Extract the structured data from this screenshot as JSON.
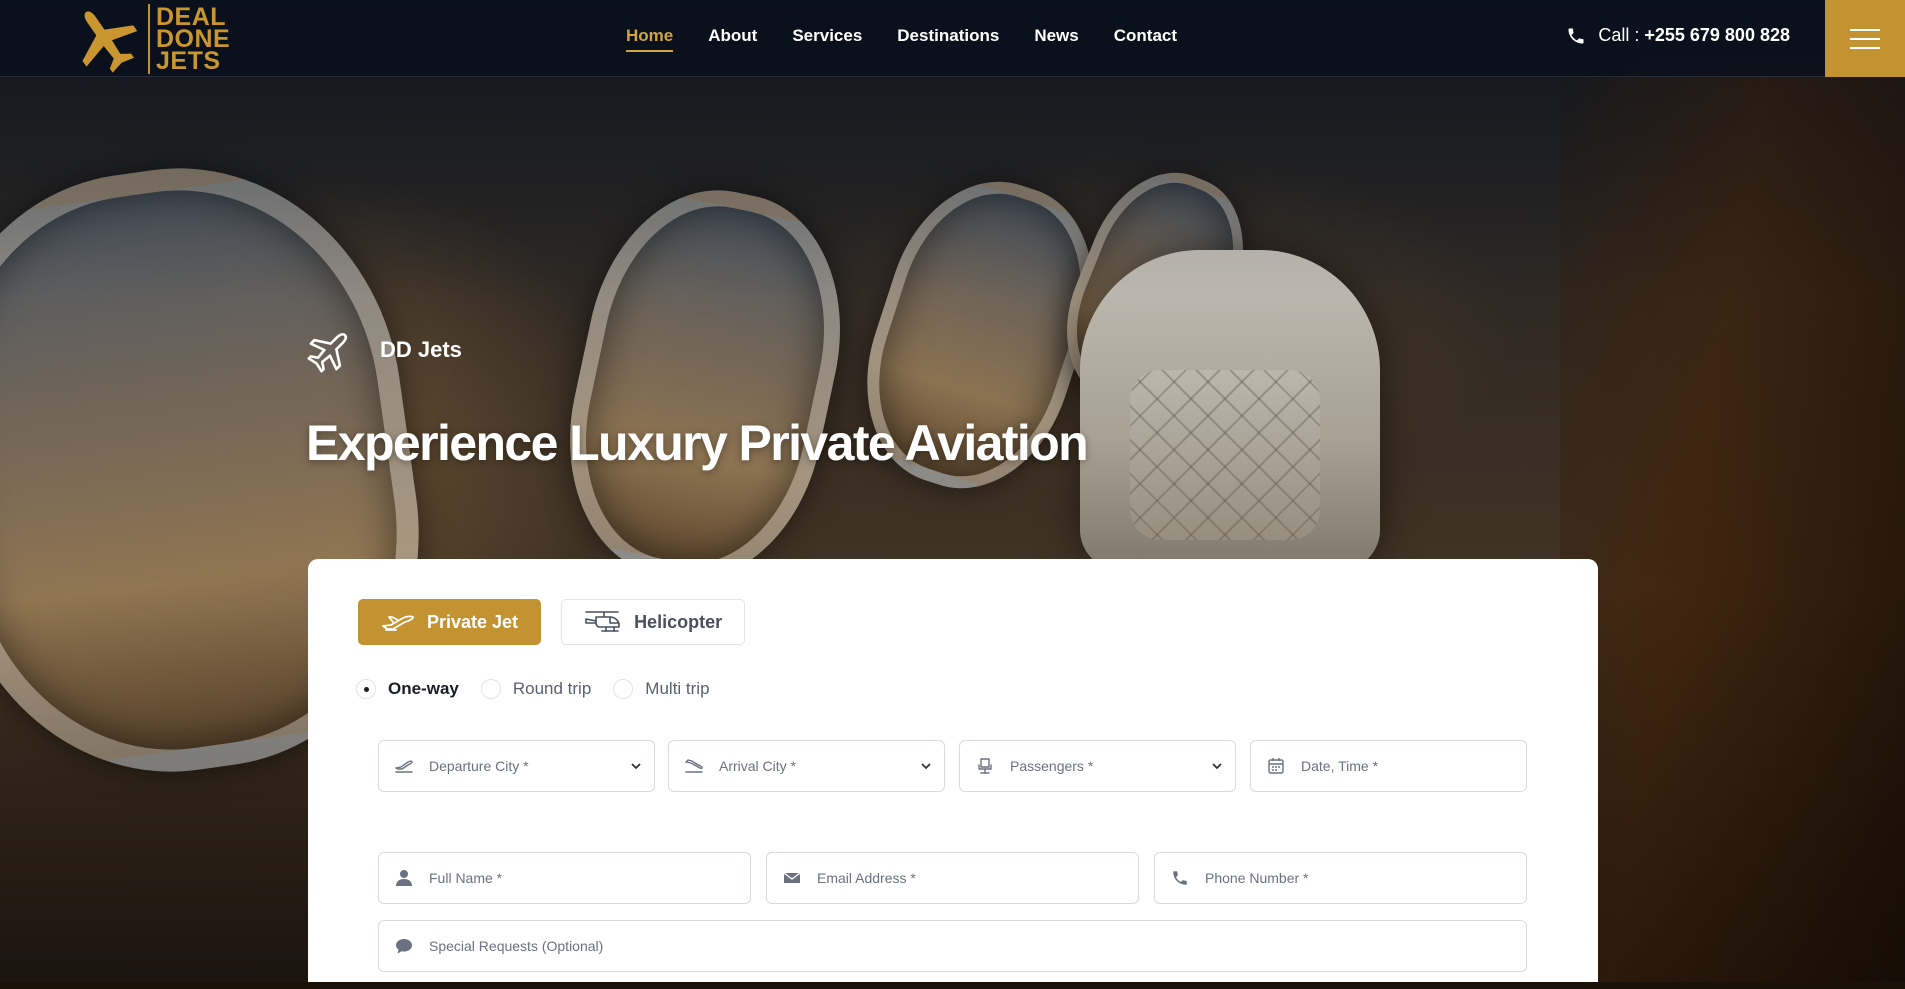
{
  "brand": {
    "logo_lines": [
      "DEAL",
      "DONE",
      "JETS"
    ],
    "accent_color": "#c39331"
  },
  "nav": {
    "items": [
      {
        "label": "Home",
        "active": true
      },
      {
        "label": "About",
        "active": false
      },
      {
        "label": "Services",
        "active": false
      },
      {
        "label": "Destinations",
        "active": false
      },
      {
        "label": "News",
        "active": false
      },
      {
        "label": "Contact",
        "active": false
      }
    ]
  },
  "header": {
    "call_prefix": "Call : ",
    "phone": "+255 679 800 828",
    "phone_icon": "phone-icon",
    "menu_icon": "hamburger-icon"
  },
  "hero": {
    "sub_label": "DD Jets",
    "sub_icon": "jet-icon",
    "title": "Experience Luxury Private Aviation"
  },
  "booking": {
    "tabs": [
      {
        "label": "Private Jet",
        "icon": "plane-icon",
        "active": true
      },
      {
        "label": "Helicopter",
        "icon": "helicopter-icon",
        "active": false
      }
    ],
    "trip_types": [
      {
        "label": "One-way",
        "checked": true
      },
      {
        "label": "Round trip",
        "checked": false
      },
      {
        "label": "Multi trip",
        "checked": false
      }
    ],
    "fields": {
      "departure": "Departure City *",
      "arrival": "Arrival City *",
      "passengers": "Passengers *",
      "date": "Date, Time *",
      "full_name": "Full Name *",
      "email": "Email Address *",
      "phone": "Phone Number *",
      "requests": "Special Requests (Optional)"
    }
  }
}
